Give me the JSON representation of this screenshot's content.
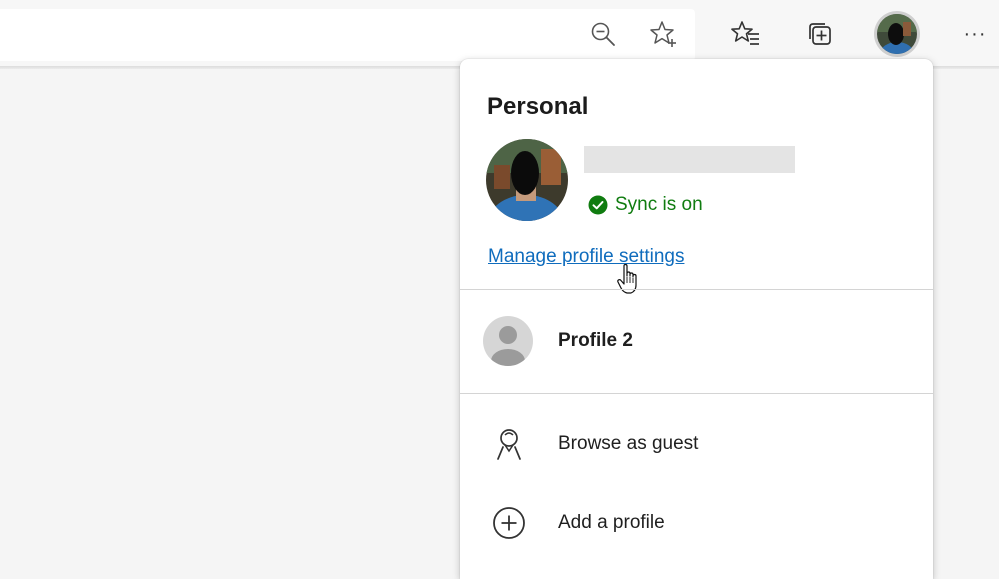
{
  "toolbar": {
    "icons": [
      "zoom-out-icon",
      "add-favorite-icon",
      "favorites-icon",
      "collections-icon",
      "profile-avatar",
      "more-icon"
    ],
    "more_label": "···"
  },
  "flyout": {
    "heading": "Personal",
    "sync_status": "Sync is on",
    "manage_link": "Manage profile settings",
    "other_profile": "Profile 2",
    "actions": {
      "guest": "Browse as guest",
      "add": "Add a profile"
    }
  },
  "colors": {
    "link": "#0f6cbd",
    "sync_green": "#107c10"
  }
}
